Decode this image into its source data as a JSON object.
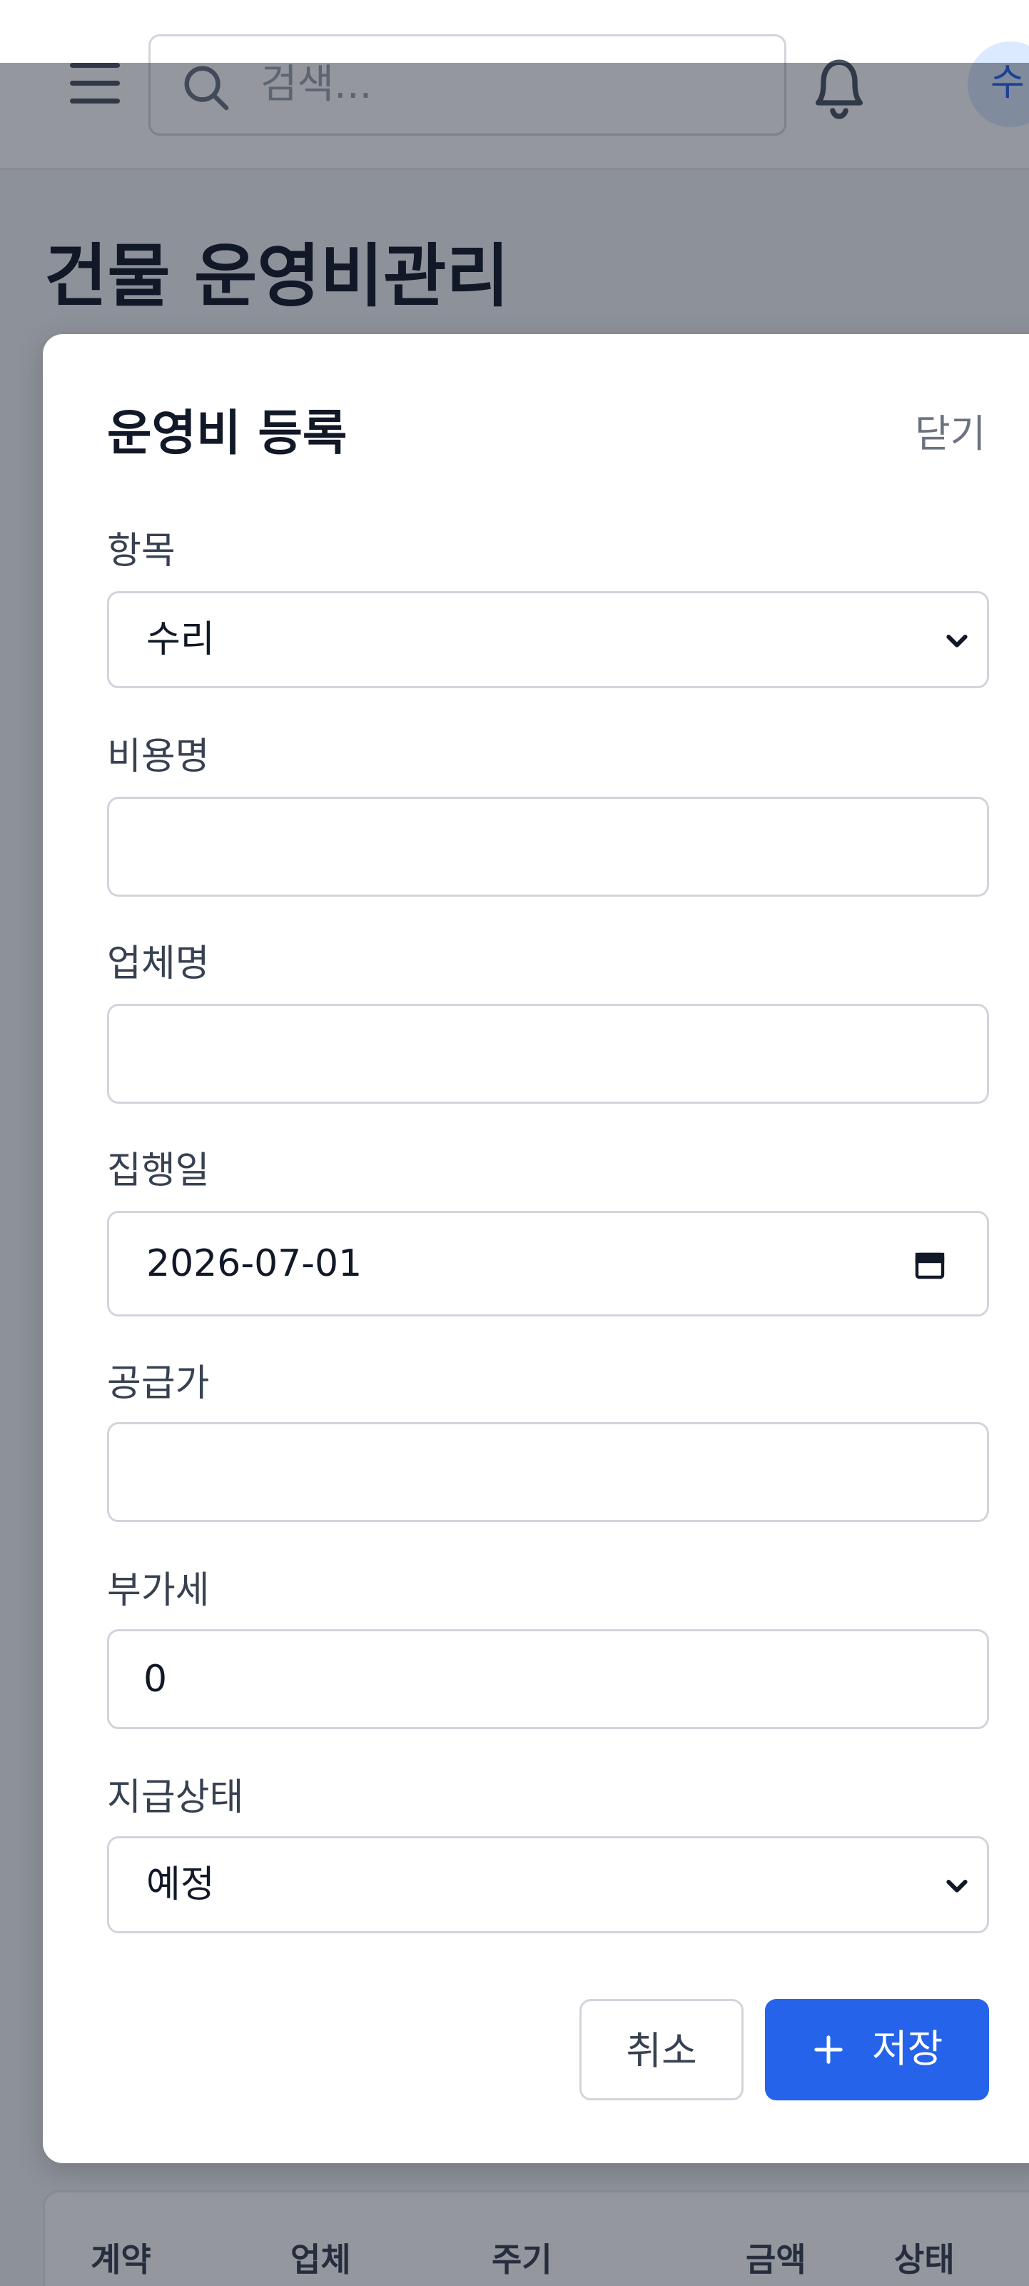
{
  "header": {
    "search_placeholder": "검색...",
    "avatar_initial": "수"
  },
  "page": {
    "title": "건물 운영비관리"
  },
  "modal": {
    "title": "운영비 등록",
    "close_label": "닫기",
    "fields": {
      "category": {
        "label": "항목",
        "value": "수리"
      },
      "expense_name": {
        "label": "비용명",
        "value": ""
      },
      "vendor": {
        "label": "업체명",
        "value": ""
      },
      "execution_date": {
        "label": "집행일",
        "value": "2026-07-01"
      },
      "supply_price": {
        "label": "공급가",
        "value": ""
      },
      "vat": {
        "label": "부가세",
        "value": "0"
      },
      "payment_status": {
        "label": "지급상태",
        "value": "예정"
      }
    },
    "cancel_label": "취소",
    "save_label": "저장"
  },
  "table": {
    "headers": [
      "계약",
      "업체",
      "주기",
      "금액",
      "상태"
    ]
  },
  "colors": {
    "accent": "#2563eb",
    "overlay": "#111827"
  }
}
